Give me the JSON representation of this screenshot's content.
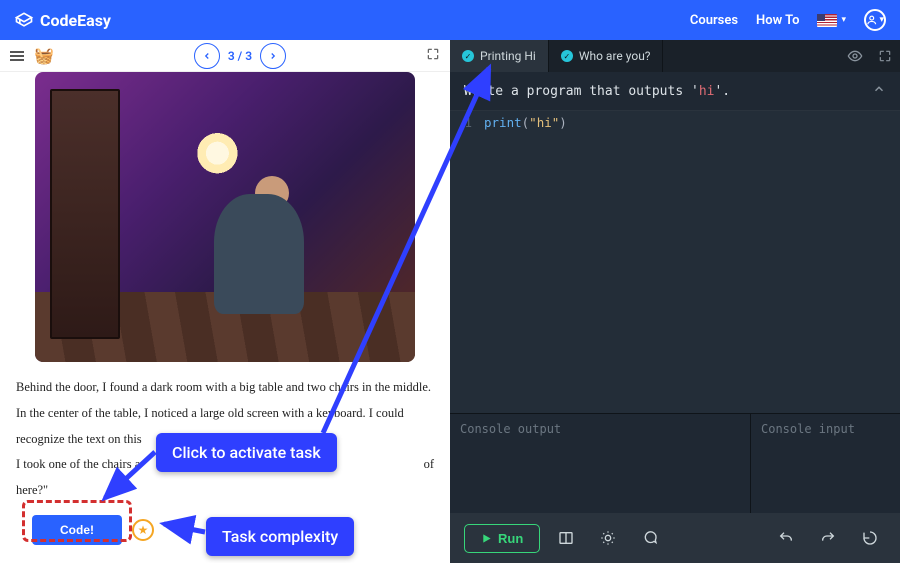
{
  "brand": "CodeEasy",
  "nav": {
    "courses": "Courses",
    "howto": "How To"
  },
  "pager": {
    "page": "3 / 3"
  },
  "story": {
    "p1": "Behind the door, I found a dark room with a big table and two chairs in the middle.",
    "p2": "In the center of the table, I noticed a large old screen with a keyboard. I could",
    "p3": "recognize the text on this",
    "p4": "I took one of the chairs a",
    "p4b": "of",
    "p5": "here?\""
  },
  "code_button": "Code!",
  "tabs": {
    "t1": "Printing Hi",
    "t2": "Who are you?"
  },
  "instruction_pre": "Write a program that outputs ",
  "instruction_q1": "'",
  "instruction_hi": "hi",
  "instruction_q2": "'",
  "instruction_post": ".",
  "editor": {
    "line1_no": "1",
    "fn": "print",
    "paren_open": "(",
    "str": "\"hi\"",
    "paren_close": ")"
  },
  "io": {
    "out_label": "Console output",
    "in_label": "Console input"
  },
  "run": "Run",
  "callouts": {
    "activate": "Click to activate task",
    "complexity": "Task complexity"
  }
}
